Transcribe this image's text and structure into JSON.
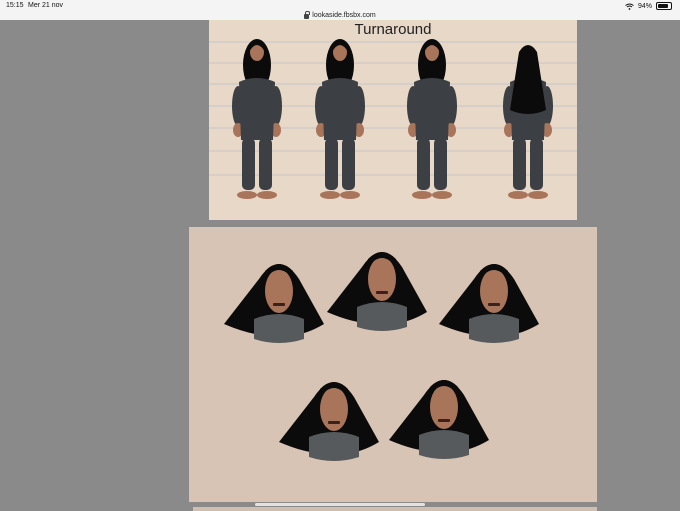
{
  "status": {
    "time": "15:15",
    "date": "Mer 21 nov",
    "battery": "94%",
    "icons": [
      "wifi-icon",
      "battery-icon"
    ]
  },
  "browser": {
    "url": "lookaside.fbsbx.com",
    "icon": "lock-icon"
  },
  "sheet1": {
    "title": "Turnaround"
  },
  "colors": {
    "background": "#8a8a8a",
    "sheet1_bg": "#e8d8c8",
    "sheet2_bg": "#d8c4b4",
    "suit": "#3c4044",
    "skin": "#a8745a",
    "hair": "#0b0b0b",
    "shirt": "#565a5c"
  }
}
